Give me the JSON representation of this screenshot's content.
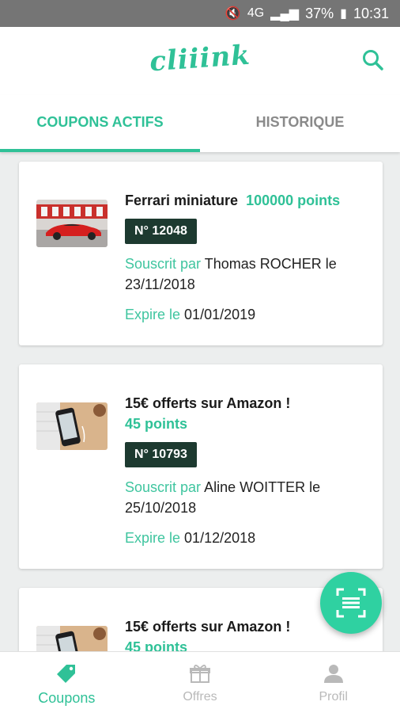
{
  "status_bar": {
    "battery": "37%",
    "time": "10:31",
    "network": "4G"
  },
  "app": {
    "logo": "cliiink"
  },
  "tabs": [
    {
      "label": "COUPONS ACTIFS",
      "active": true
    },
    {
      "label": "HISTORIQUE",
      "active": false
    }
  ],
  "coupons": [
    {
      "title": "Ferrari miniature",
      "points": "100000 points",
      "number": "N° 12048",
      "subscribed_label": "Souscrit par",
      "subscriber": "Thomas ROCHER le 23/11/2018",
      "expires_label": "Expire le",
      "expires": "01/01/2019",
      "image": "red-sports-car"
    },
    {
      "title": "15€ offerts sur Amazon !",
      "points": "45 points",
      "number": "N° 10793",
      "subscribed_label": "Souscrit par",
      "subscriber": "Aline WOITTER le 25/10/2018",
      "expires_label": "Expire le",
      "expires": "01/12/2018",
      "image": "smartphone-on-desk"
    },
    {
      "title": "15€ offerts sur Amazon !",
      "points": "45 points",
      "image": "smartphone-on-desk"
    }
  ],
  "bottom_nav": [
    {
      "label": "Coupons",
      "icon": "tag-icon",
      "active": true
    },
    {
      "label": "Offres",
      "icon": "gift-icon",
      "active": false
    },
    {
      "label": "Profil",
      "icon": "person-icon",
      "active": false
    }
  ],
  "colors": {
    "accent": "#2fc197",
    "badge": "#1d3a30",
    "status_bar": "#757575"
  }
}
